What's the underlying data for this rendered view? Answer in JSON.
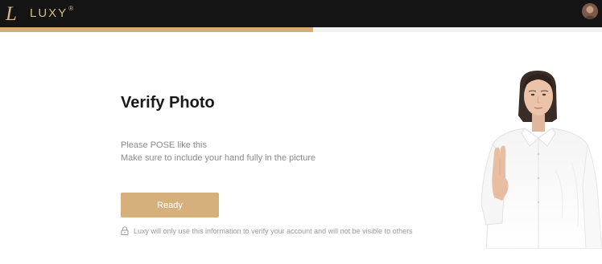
{
  "header": {
    "logo_text": "LUXY",
    "logo_mark": "L",
    "registered_mark": "®",
    "avatar_icon": "user-avatar"
  },
  "progress": {
    "fraction": 0.52,
    "fill_color": "#d5ad75",
    "track_color": "#f2f2f2"
  },
  "main": {
    "title": "Verify Photo",
    "instruction_line1": "Please POSE like this",
    "instruction_line2": "Make sure to include your hand fully in the picture",
    "ready_button": "Ready",
    "privacy_note": "Luxy will only use this information to verify your account and will not be visible to others"
  },
  "colors": {
    "header_bg": "#141414",
    "brand_gold": "#d6b886",
    "button_bg": "#d5b07d"
  }
}
